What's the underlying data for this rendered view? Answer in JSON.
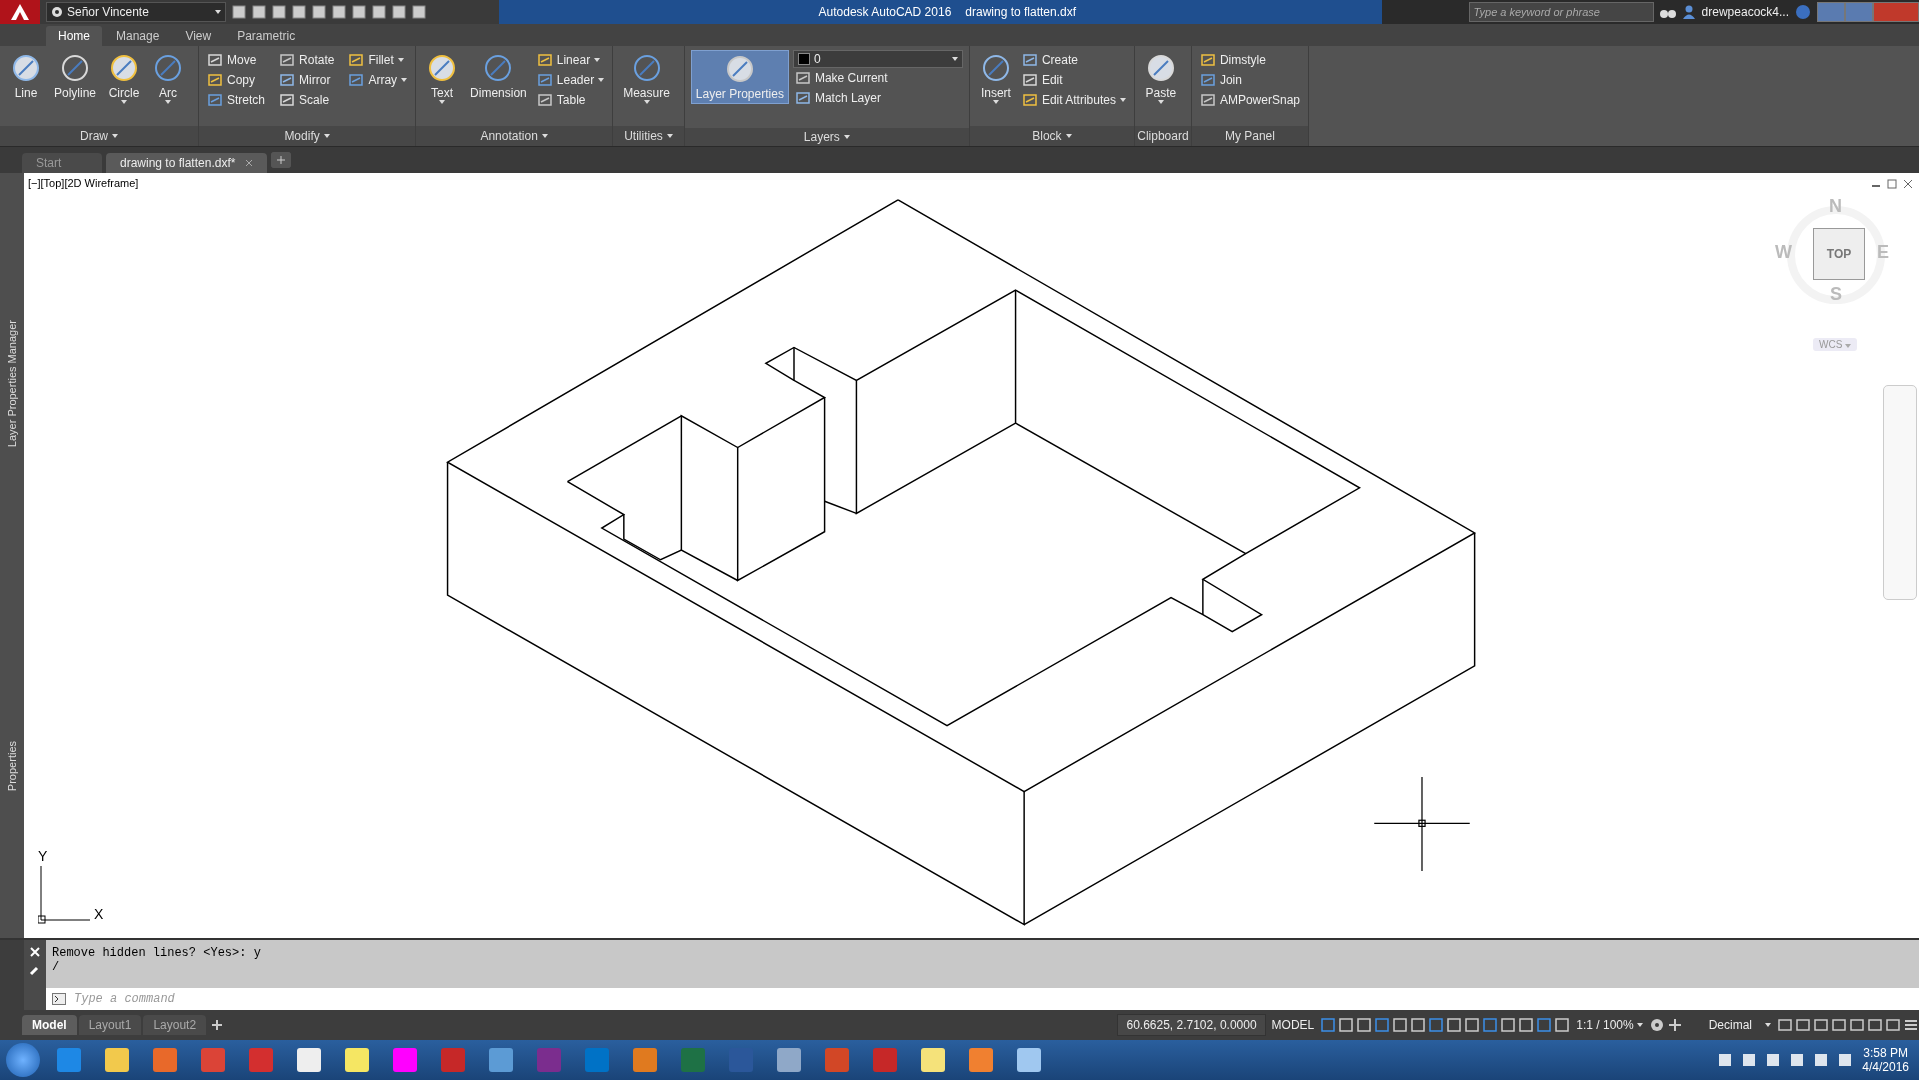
{
  "title_bar": {
    "workspace": "Señor Vincente",
    "app_name": "Autodesk AutoCAD 2016",
    "file_name": "drawing to flatten.dxf",
    "search": {
      "placeholder": "Type a keyword or phrase"
    },
    "user": "drewpeacock4..."
  },
  "ribbon_tabs": [
    {
      "label": "Home",
      "selected": true
    },
    {
      "label": "Manage",
      "selected": false
    },
    {
      "label": "View",
      "selected": false
    },
    {
      "label": "Parametric",
      "selected": false
    }
  ],
  "ribbon_panels": [
    {
      "title": "Draw",
      "dropdown": true,
      "large_tools": [
        {
          "label": "Line",
          "dropdown": false
        },
        {
          "label": "Polyline",
          "dropdown": false
        },
        {
          "label": "Circle",
          "dropdown": true
        },
        {
          "label": "Arc",
          "dropdown": true
        }
      ]
    },
    {
      "title": "Modify",
      "dropdown": true,
      "small_tools": [
        {
          "label": "Move",
          "dropdown": false
        },
        {
          "label": "Copy",
          "dropdown": false
        },
        {
          "label": "Stretch",
          "dropdown": false
        },
        {
          "label": "Rotate",
          "dropdown": false
        },
        {
          "label": "Mirror",
          "dropdown": false
        },
        {
          "label": "Scale",
          "dropdown": false
        },
        {
          "label": "Fillet",
          "dropdown": true
        },
        {
          "label": "Array",
          "dropdown": true
        }
      ]
    },
    {
      "title": "Annotation",
      "dropdown": true,
      "large_tools": [
        {
          "label": "Text",
          "dropdown": true
        },
        {
          "label": "Dimension",
          "dropdown": false
        }
      ],
      "small_tools": [
        {
          "label": "Linear",
          "dropdown": true
        },
        {
          "label": "Leader",
          "dropdown": true
        },
        {
          "label": "Table",
          "dropdown": false
        }
      ]
    },
    {
      "title": "Utilities",
      "dropdown": true,
      "large_tools": [
        {
          "label": "Measure",
          "dropdown": true
        }
      ]
    },
    {
      "title": "Layers",
      "dropdown": true,
      "large_tools": [
        {
          "label": "Layer Properties",
          "dropdown": false
        }
      ],
      "layer_selector": {
        "value": "0"
      },
      "small_tools": [
        {
          "label": "Make Current",
          "dropdown": false
        },
        {
          "label": "Match Layer",
          "dropdown": false
        }
      ]
    },
    {
      "title": "Block",
      "dropdown": true,
      "large_tools": [
        {
          "label": "Insert",
          "dropdown": true
        }
      ],
      "small_tools": [
        {
          "label": "Create",
          "dropdown": false
        },
        {
          "label": "Edit",
          "dropdown": false
        },
        {
          "label": "Edit Attributes",
          "dropdown": true
        }
      ]
    },
    {
      "title": "Clipboard",
      "dropdown": false,
      "large_tools": [
        {
          "label": "Paste",
          "dropdown": true
        }
      ]
    },
    {
      "title": "My Panel",
      "dropdown": false,
      "small_tools": [
        {
          "label": "Dimstyle",
          "dropdown": false
        },
        {
          "label": "Join",
          "dropdown": false
        },
        {
          "label": "AMPowerSnap",
          "dropdown": false
        }
      ]
    }
  ],
  "file_tabs": [
    {
      "label": "Start",
      "selected": false
    },
    {
      "label": "drawing to flatten.dxf*",
      "selected": true
    }
  ],
  "side_palettes": [
    "Layer Properties Manager",
    "Properties"
  ],
  "viewport": {
    "label": "[−][Top][2D Wireframe]",
    "viewcube": {
      "face": "TOP",
      "north": "N",
      "south": "S",
      "east": "E",
      "west": "W",
      "ucs": "WCS"
    },
    "ucs_icon": {
      "x": "X",
      "y": "Y"
    }
  },
  "command_line": {
    "history": [
      "Remove hidden lines? <Yes>: y",
      "/"
    ],
    "placeholder": "Type a command"
  },
  "layout_tabs": [
    {
      "label": "Model",
      "selected": true
    },
    {
      "label": "Layout1",
      "selected": false
    },
    {
      "label": "Layout2",
      "selected": false
    }
  ],
  "status_bar": {
    "coordinates": "60.6625, 2.7102, 0.0000",
    "space": "MODEL",
    "scale": "1:1 / 100%",
    "units": "Decimal"
  },
  "taskbar": {
    "time": "3:58 PM",
    "date": "4/4/2016"
  }
}
